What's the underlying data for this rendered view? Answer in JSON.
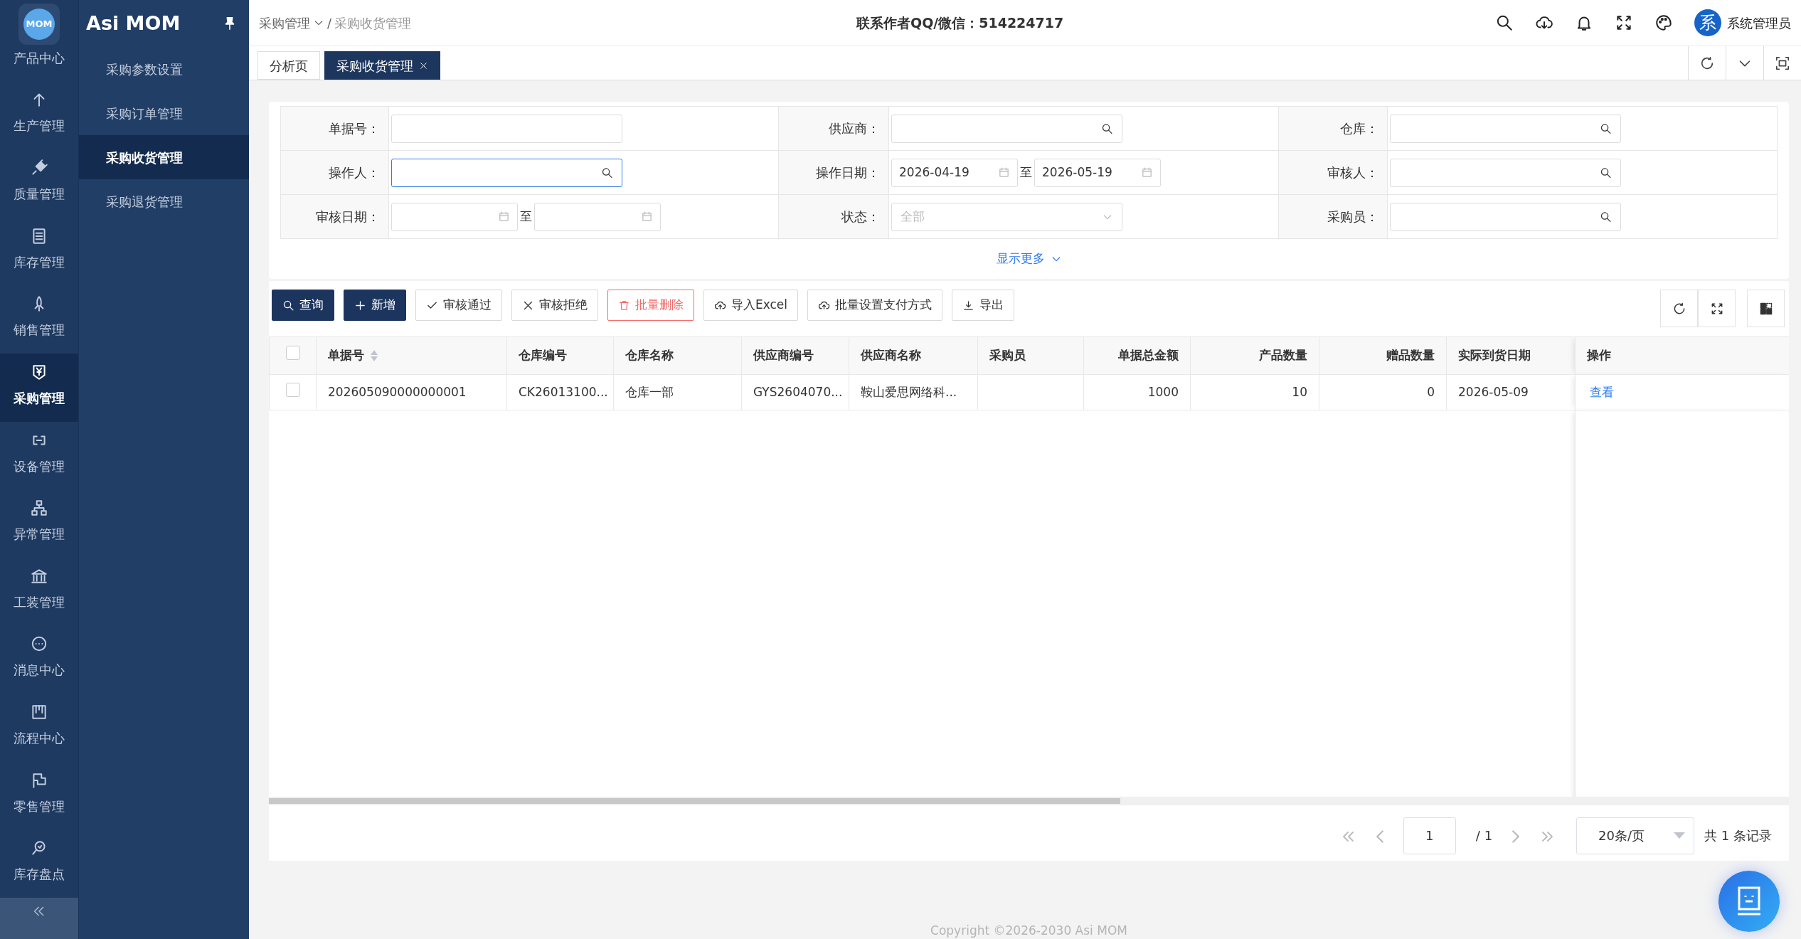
{
  "sidebar": {
    "logo_text": "MOM",
    "title": "Asi MOM",
    "rail": [
      {
        "label": "产品中心",
        "selected": false
      },
      {
        "label": "生产管理",
        "selected": false
      },
      {
        "label": "质量管理",
        "selected": false
      },
      {
        "label": "库存管理",
        "selected": false
      },
      {
        "label": "销售管理",
        "selected": false
      },
      {
        "label": "采购管理",
        "selected": true
      },
      {
        "label": "设备管理",
        "selected": false
      },
      {
        "label": "异常管理",
        "selected": false
      },
      {
        "label": "工装管理",
        "selected": false
      },
      {
        "label": "消息中心",
        "selected": false
      },
      {
        "label": "流程中心",
        "selected": false
      },
      {
        "label": "零售管理",
        "selected": false
      },
      {
        "label": "库存盘点",
        "selected": false
      }
    ],
    "submenu": [
      {
        "label": "采购参数设置",
        "selected": false
      },
      {
        "label": "采购订单管理",
        "selected": false
      },
      {
        "label": "采购收货管理",
        "selected": true
      },
      {
        "label": "采购退货管理",
        "selected": false
      }
    ]
  },
  "topbar": {
    "breadcrumb": [
      "采购管理",
      "采购收货管理"
    ],
    "separator": "/",
    "contact": "联系作者QQ/微信：514224717",
    "avatar_text": "系",
    "user": "系统管理员"
  },
  "tabs": [
    {
      "label": "分析页",
      "selected": false,
      "closable": false
    },
    {
      "label": "采购收货管理",
      "selected": true,
      "closable": true
    }
  ],
  "filters": [
    {
      "label": "单据号：",
      "kind": "text",
      "focused": false
    },
    {
      "label": "供应商：",
      "kind": "lookup",
      "focused": false
    },
    {
      "label": "仓库：",
      "kind": "lookup",
      "focused": false
    },
    {
      "label": "操作人：",
      "kind": "lookup",
      "focused": true
    },
    {
      "label": "操作日期：",
      "kind": "daterange",
      "start": "2026-04-19",
      "end": "2026-05-19",
      "separator": "至",
      "focused": false
    },
    {
      "label": "审核人：",
      "kind": "lookup",
      "focused": false
    },
    {
      "label": "审核日期：",
      "kind": "daterange",
      "separator": "至",
      "focused": false
    },
    {
      "label": "状态：",
      "kind": "select",
      "placeholder": "全部",
      "focused": false
    },
    {
      "label": "采购员：",
      "kind": "lookup",
      "focused": false
    }
  ],
  "show_more": "显示更多",
  "toolbar": [
    {
      "label": "查询",
      "kind": "primary"
    },
    {
      "label": "新增",
      "kind": "primary"
    },
    {
      "label": "审核通过",
      "kind": "default"
    },
    {
      "label": "审核拒绝",
      "kind": "default"
    },
    {
      "label": "批量删除",
      "kind": "danger"
    },
    {
      "label": "导入Excel",
      "kind": "default"
    },
    {
      "label": "批量设置支付方式",
      "kind": "default"
    },
    {
      "label": "导出",
      "kind": "default"
    }
  ],
  "table": {
    "header_checked": false,
    "columns": [
      {
        "label": "单据号",
        "sortable": true
      },
      {
        "label": "仓库编号",
        "sortable": false
      },
      {
        "label": "仓库名称",
        "sortable": false
      },
      {
        "label": "供应商编号",
        "sortable": false
      },
      {
        "label": "供应商名称",
        "sortable": false
      },
      {
        "label": "采购员",
        "sortable": false
      },
      {
        "label": "单据总金额",
        "sortable": false
      },
      {
        "label": "产品数量",
        "sortable": false
      },
      {
        "label": "赠品数量",
        "sortable": false
      },
      {
        "label": "实际到货日期",
        "sortable": false
      },
      {
        "label": "操作",
        "sortable": false
      }
    ],
    "rows": [
      {
        "checked": false,
        "cells": [
          "202605090000000001",
          "CK26013100...",
          "仓库一部",
          "GYS2604070...",
          "鞍山爱思网络科...",
          "",
          "1000",
          "10",
          "0",
          "2026-05-09"
        ],
        "action": "查看"
      }
    ]
  },
  "pagination": {
    "page": "1",
    "total_pages": "/ 1",
    "page_size": "20条/页",
    "summary": "共 1 条记录"
  },
  "footer": "Copyright ©2026-2030 Asi MOM"
}
